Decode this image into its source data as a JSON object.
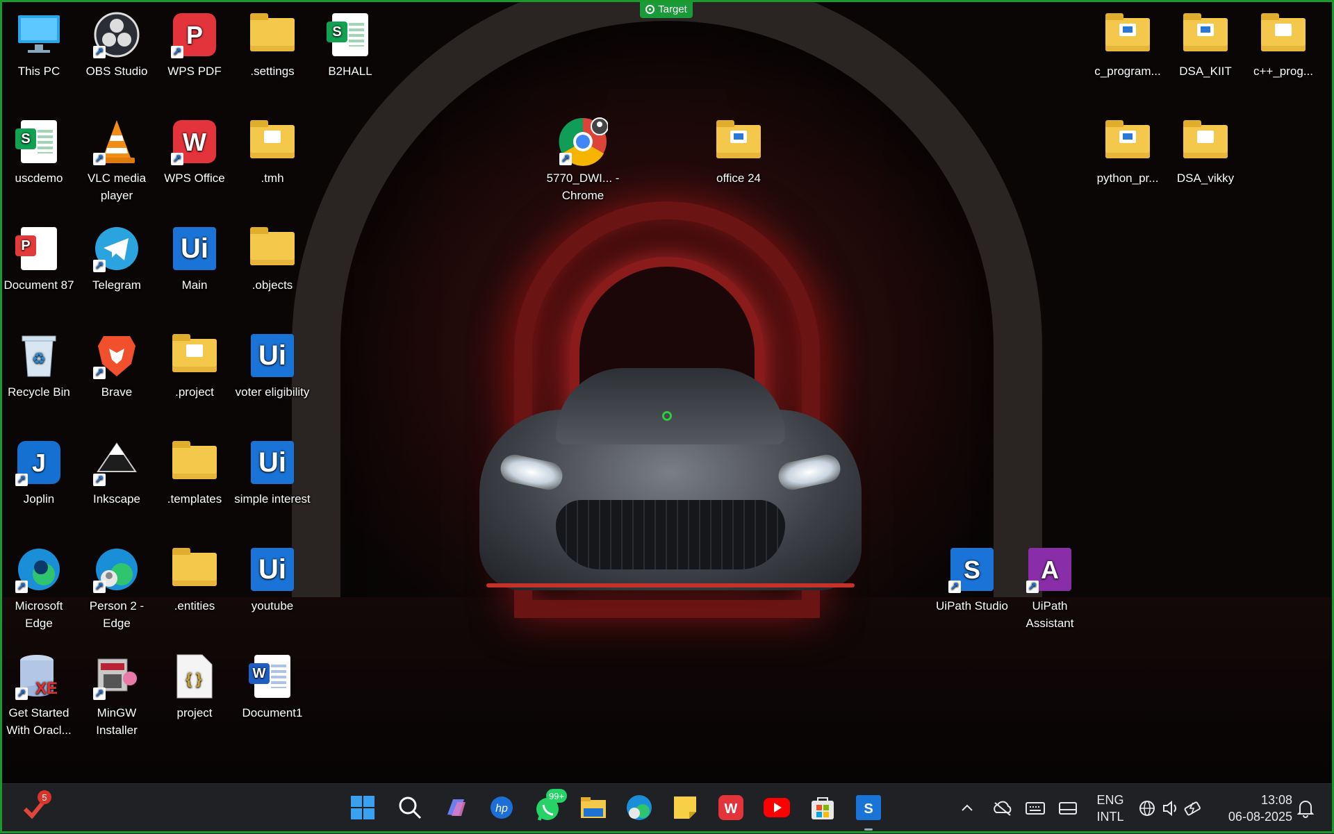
{
  "target_badge": "Target",
  "desktop_icons": {
    "this_pc": "This PC",
    "obs": "OBS Studio",
    "wps_pdf": "WPS PDF",
    "settings": ".settings",
    "b2hall": "B2HALL",
    "uscdemo": "uscdemo",
    "vlc": "VLC media player",
    "wps_office": "WPS Office",
    "tmh": ".tmh",
    "document87": "Document 87",
    "telegram": "Telegram",
    "main": "Main",
    "objects": ".objects",
    "recycle_bin": "Recycle Bin",
    "brave": "Brave",
    "project_folder": ".project",
    "voter": "voter eligibility",
    "joplin": "Joplin",
    "inkscape": "Inkscape",
    "templates": ".templates",
    "simple_interest": "simple interest",
    "edge": "Microsoft Edge",
    "person2_edge": "Person 2 - Edge",
    "entities": ".entities",
    "youtube": "youtube",
    "oracle": "Get Started With Oracl...",
    "mingw": "MinGW Installer",
    "project_json": "project",
    "document1": "Document1",
    "chrome_5770": "5770_DWI... - Chrome",
    "office24": "office 24",
    "c_program": "c_program...",
    "dsa_kiit": "DSA_KIIT",
    "cpp_prog": "c++_prog...",
    "python_pr": "python_pr...",
    "dsa_vikky": "DSA_vikky",
    "uipath_studio": "UiPath Studio",
    "uipath_assistant": "UiPath Assistant"
  },
  "taskbar": {
    "notification_count": "5",
    "whatsapp_badge": "99+",
    "language_line1": "ENG",
    "language_line2": "INTL",
    "time": "13:08",
    "date": "06-08-2025"
  }
}
